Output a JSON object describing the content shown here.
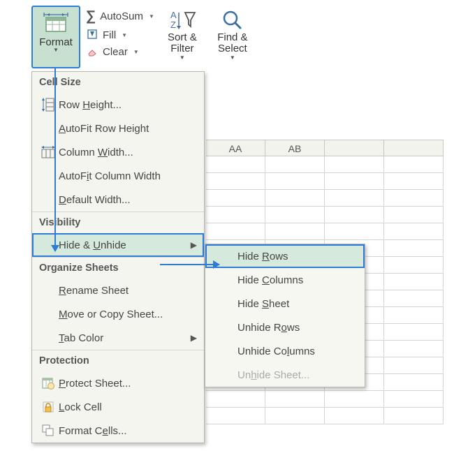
{
  "ribbon": {
    "format_label": "Format",
    "autosum_label": "AutoSum",
    "fill_label": "Fill",
    "clear_label": "Clear",
    "sortfilter_label": "Sort & Filter",
    "findselect_label": "Find & Select"
  },
  "menu": {
    "section_cell_size": "Cell Size",
    "row_height": "Row Height...",
    "autofit_row_height": "AutoFit Row Height",
    "column_width": "Column Width...",
    "autofit_column_width": "AutoFit Column Width",
    "default_width": "Default Width...",
    "section_visibility": "Visibility",
    "hide_unhide": "Hide & Unhide",
    "section_organize": "Organize Sheets",
    "rename_sheet": "Rename Sheet",
    "move_copy_sheet": "Move or Copy Sheet...",
    "tab_color": "Tab Color",
    "section_protection": "Protection",
    "protect_sheet": "Protect Sheet...",
    "lock_cell": "Lock Cell",
    "format_cells": "Format Cells..."
  },
  "submenu": {
    "hide_rows": "Hide Rows",
    "hide_columns": "Hide Columns",
    "hide_sheet": "Hide Sheet",
    "unhide_rows": "Unhide Rows",
    "unhide_columns": "Unhide Columns",
    "unhide_sheet": "Unhide Sheet..."
  },
  "sheet": {
    "col1": "AA",
    "col2": "AB"
  },
  "colors": {
    "accent": "#2f7bd6",
    "highlight_bg": "#d5eadc"
  }
}
